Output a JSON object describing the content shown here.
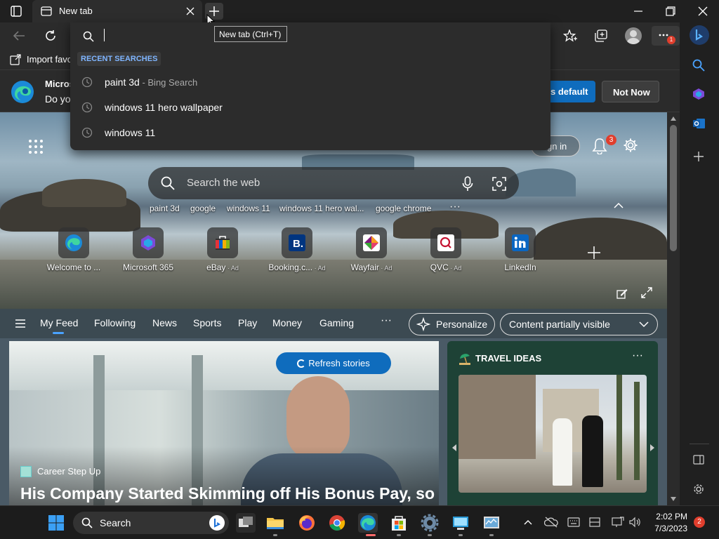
{
  "browser": {
    "tab_title": "New tab",
    "new_tab_tooltip": "New tab (Ctrl+T)",
    "fav_import_label": "Import favo",
    "menu_badge": "1"
  },
  "banner": {
    "line1": "Micros",
    "line2": "Do yo",
    "default_button": "s default",
    "not_now_button": "Not Now"
  },
  "dropdown": {
    "section_label": "RECENT SEARCHES",
    "items": [
      {
        "text": "paint 3d",
        "sub": " - Bing Search"
      },
      {
        "text": "windows 11 hero wallpaper",
        "sub": ""
      },
      {
        "text": "windows 11",
        "sub": ""
      }
    ]
  },
  "newtab": {
    "sign_in": "gn in",
    "notif_count": "3",
    "search_placeholder": "Search the web",
    "suggestions": [
      "paint 3d",
      "google",
      "windows 11",
      "windows 11 hero wal...",
      "google chrome"
    ],
    "tiles": [
      {
        "label": "Welcome to ...",
        "ad": ""
      },
      {
        "label": "Microsoft 365",
        "ad": ""
      },
      {
        "label": "eBay",
        "ad": " · Ad"
      },
      {
        "label": "Booking.c...",
        "ad": " · Ad"
      },
      {
        "label": "Wayfair",
        "ad": " · Ad"
      },
      {
        "label": "QVC",
        "ad": " · Ad"
      },
      {
        "label": "LinkedIn",
        "ad": ""
      }
    ],
    "feed_tabs": [
      "My Feed",
      "Following",
      "News",
      "Sports",
      "Play",
      "Money",
      "Gaming"
    ],
    "personalize": "Personalize",
    "content_visible": "Content partially visible",
    "refresh": "Refresh stories",
    "story_source": "Career Step Up",
    "story_headline": "His Company Started Skimming off His Bonus Pay, so",
    "travel_title": "TRAVEL IDEAS"
  },
  "taskbar": {
    "search_label": "Search",
    "time": "2:02 PM",
    "date": "7/3/2023",
    "notif_count": "2"
  },
  "colors": {
    "accent": "#0f6cbd",
    "badge": "#e03e2d"
  }
}
